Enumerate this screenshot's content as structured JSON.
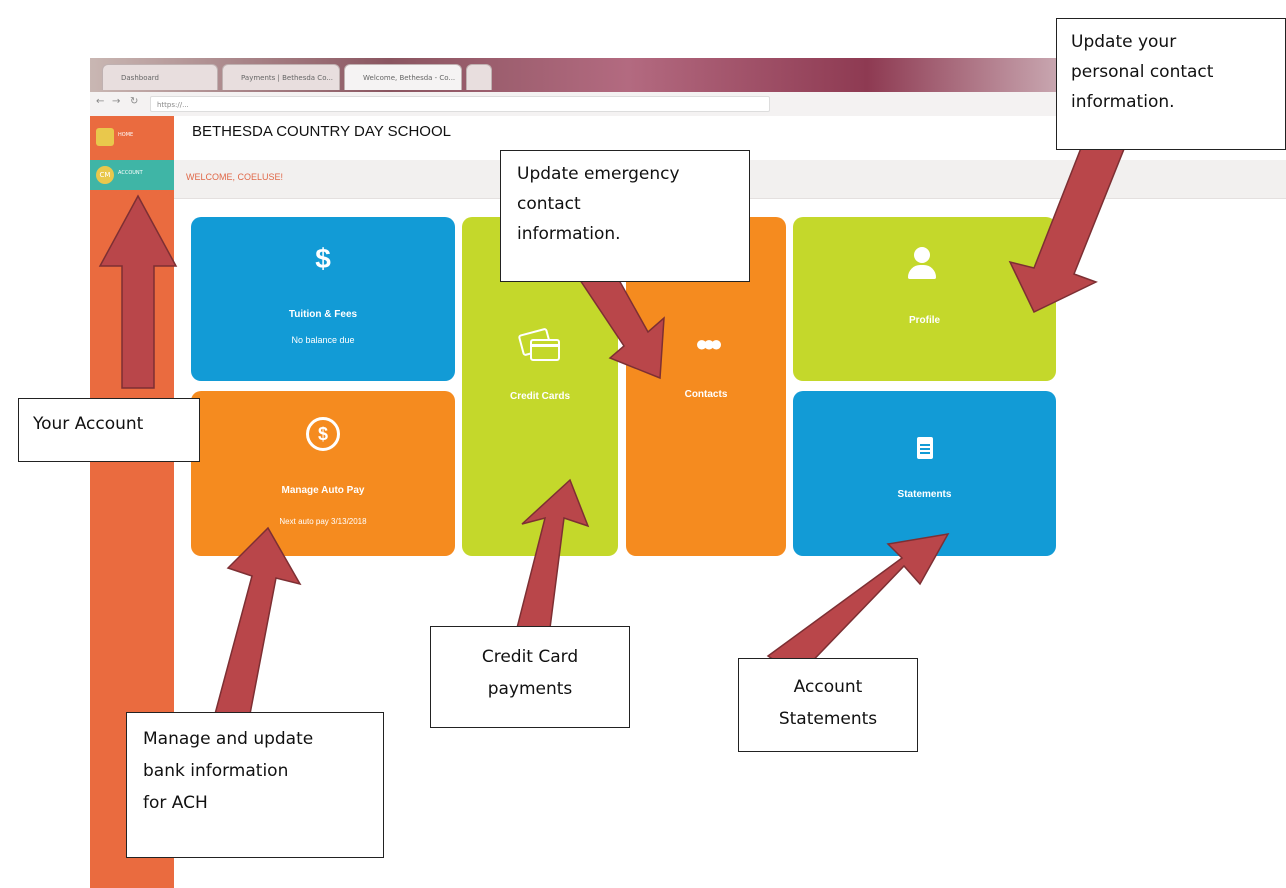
{
  "browser": {
    "tabs": [
      "Dashboard",
      "Payments | Bethesda Co...",
      "Welcome, Bethesda - Co..."
    ],
    "url": "https://..."
  },
  "sidebar": {
    "items": [
      {
        "label": "HOME",
        "badge": ""
      },
      {
        "label": "ACCOUNT",
        "badge": "CM"
      }
    ]
  },
  "header": {
    "school_name": "BETHESDA COUNTRY DAY SCHOOL",
    "welcome": "WELCOME, COELUSE!"
  },
  "tiles": {
    "tuition": {
      "title": "Tuition & Fees",
      "subtitle": "No balance due",
      "color": "#129bd6"
    },
    "autopay": {
      "title": "Manage Auto Pay",
      "subtitle": "Next auto pay 3/13/2018",
      "color": "#f58b1f"
    },
    "credit": {
      "title": "Credit Cards",
      "color": "#c4d82b"
    },
    "contacts": {
      "title": "Contacts",
      "color": "#f58b1f"
    },
    "profile": {
      "title": "Profile",
      "color": "#c4d82b"
    },
    "statements": {
      "title": "Statements",
      "color": "#129bd6"
    }
  },
  "annotations": {
    "profile": [
      "Update your",
      "personal contact",
      "information."
    ],
    "emergency": [
      "Update emergency",
      "contact",
      "information."
    ],
    "account": [
      "Your Account"
    ],
    "credit": [
      "Credit Card",
      "payments"
    ],
    "statements": [
      "Account",
      "Statements"
    ],
    "bank": [
      "Manage and update",
      "bank information",
      "for ACH"
    ]
  },
  "colors": {
    "sidebar": "#ea6b3f",
    "arrow": "#b9464a",
    "active_side": "#3fb5a6"
  }
}
